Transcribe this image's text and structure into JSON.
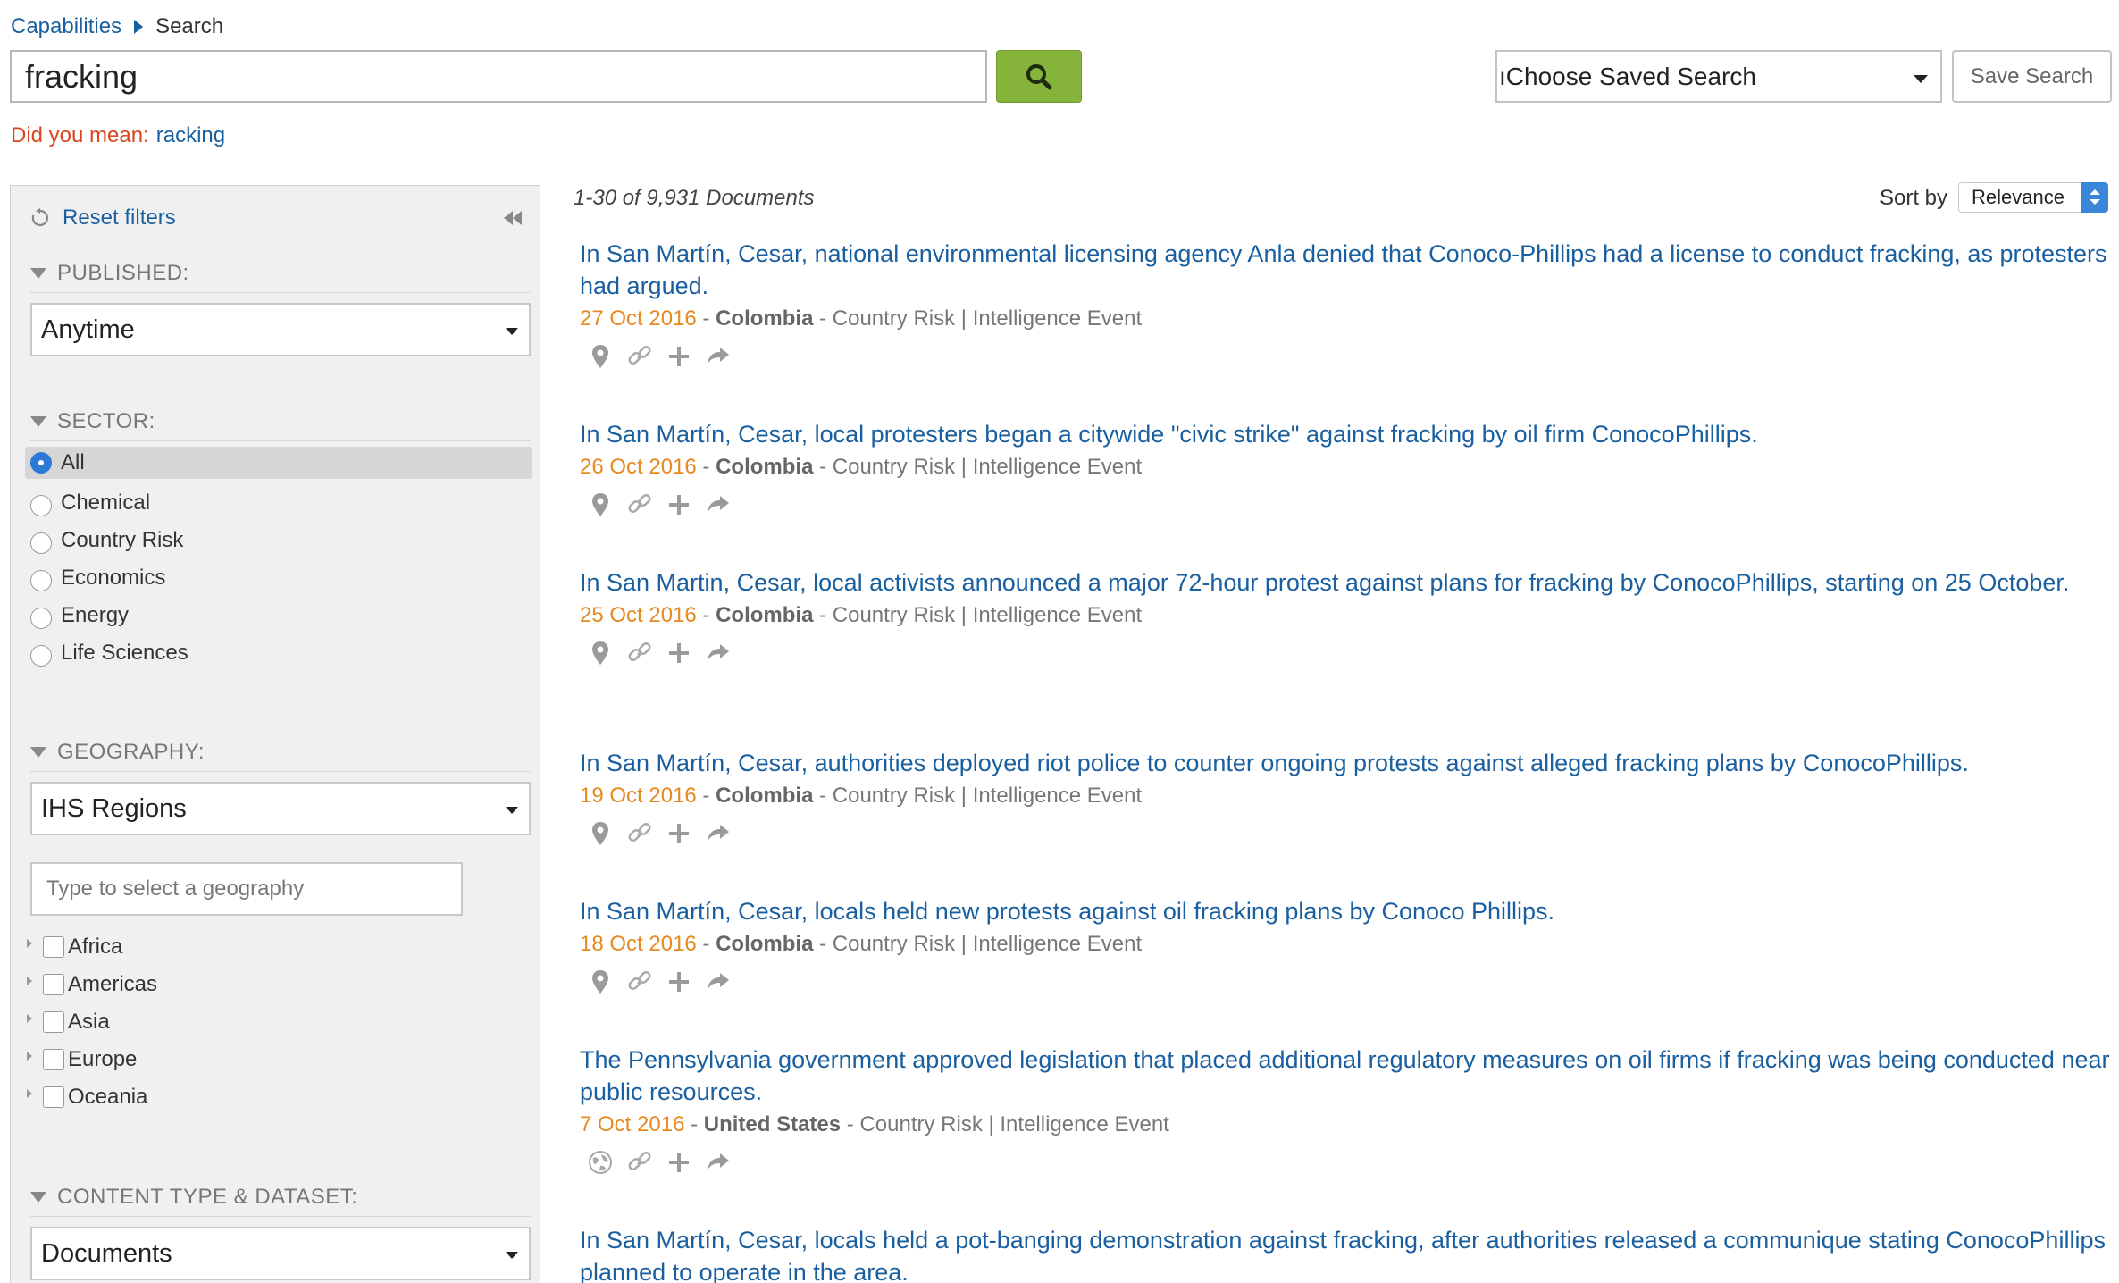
{
  "breadcrumb": {
    "parent": "Capabilities",
    "current": "Search"
  },
  "search": {
    "query": "fracking",
    "button_icon": "search-icon"
  },
  "saved_search": {
    "selected": "ıChoose Saved Search",
    "save_label": "Save Search"
  },
  "suggestion": {
    "prefix": "Did you mean:",
    "term": "racking"
  },
  "sidebar": {
    "reset_label": "Reset filters",
    "published": {
      "heading": "PUBLISHED:",
      "selected": "Anytime"
    },
    "sector": {
      "heading": "SECTOR:",
      "options": [
        {
          "label": "All",
          "selected": true
        },
        {
          "label": "Chemical",
          "selected": false
        },
        {
          "label": "Country Risk",
          "selected": false
        },
        {
          "label": "Economics",
          "selected": false
        },
        {
          "label": "Energy",
          "selected": false
        },
        {
          "label": "Life Sciences",
          "selected": false
        }
      ]
    },
    "geography": {
      "heading": "GEOGRAPHY:",
      "selected": "IHS Regions",
      "input_placeholder": "Type to select a geography",
      "regions": [
        "Africa",
        "Americas",
        "Asia",
        "Europe",
        "Oceania"
      ]
    },
    "content_type": {
      "heading": "CONTENT TYPE & DATASET:",
      "selected": "Documents"
    }
  },
  "results": {
    "count_text": "1-30 of 9,931 Documents",
    "sort_label": "Sort by",
    "sort_value": "Relevance",
    "items": [
      {
        "title": "In San Martín, Cesar, national environmental licensing agency Anla denied that Conoco-Phillips had a license to conduct fracking, as protesters had argued.",
        "date": "27 Oct 2016",
        "country": "Colombia",
        "category": "Country Risk | Intelligence Event",
        "location_icon": "map-pin-icon"
      },
      {
        "title": "In San Martín, Cesar, local protesters began a citywide \"civic strike\" against fracking by oil firm ConocoPhillips.",
        "date": "26 Oct 2016",
        "country": "Colombia",
        "category": "Country Risk | Intelligence Event",
        "location_icon": "map-pin-icon"
      },
      {
        "title": "In San Martin, Cesar, local activists announced a major 72-hour protest against plans for fracking by ConocoPhillips, starting on 25 October.",
        "date": "25 Oct 2016",
        "country": "Colombia",
        "category": "Country Risk | Intelligence Event",
        "location_icon": "map-pin-icon"
      },
      {
        "title": "In San Martín, Cesar, authorities deployed riot police to counter ongoing protests against alleged fracking plans by ConocoPhillips.",
        "date": "19 Oct 2016",
        "country": "Colombia",
        "category": "Country Risk | Intelligence Event",
        "location_icon": "map-pin-icon"
      },
      {
        "title": "In San Martín, Cesar, locals held new protests against oil fracking plans by Conoco Phillips.",
        "date": "18 Oct 2016",
        "country": "Colombia",
        "category": "Country Risk | Intelligence Event",
        "location_icon": "map-pin-icon"
      },
      {
        "title": "The Pennsylvania government approved legislation that placed additional regulatory measures on oil firms if fracking was being conducted near public resources.",
        "date": "7 Oct 2016",
        "country": "United States",
        "category": "Country Risk | Intelligence Event",
        "location_icon": "globe-icon"
      },
      {
        "title": "In San Martín, Cesar, locals held a pot-banging demonstration against fracking, after authorities released a communique stating ConocoPhillips planned to operate in the area.",
        "date": "",
        "country": "",
        "category": "",
        "location_icon": ""
      }
    ]
  }
}
